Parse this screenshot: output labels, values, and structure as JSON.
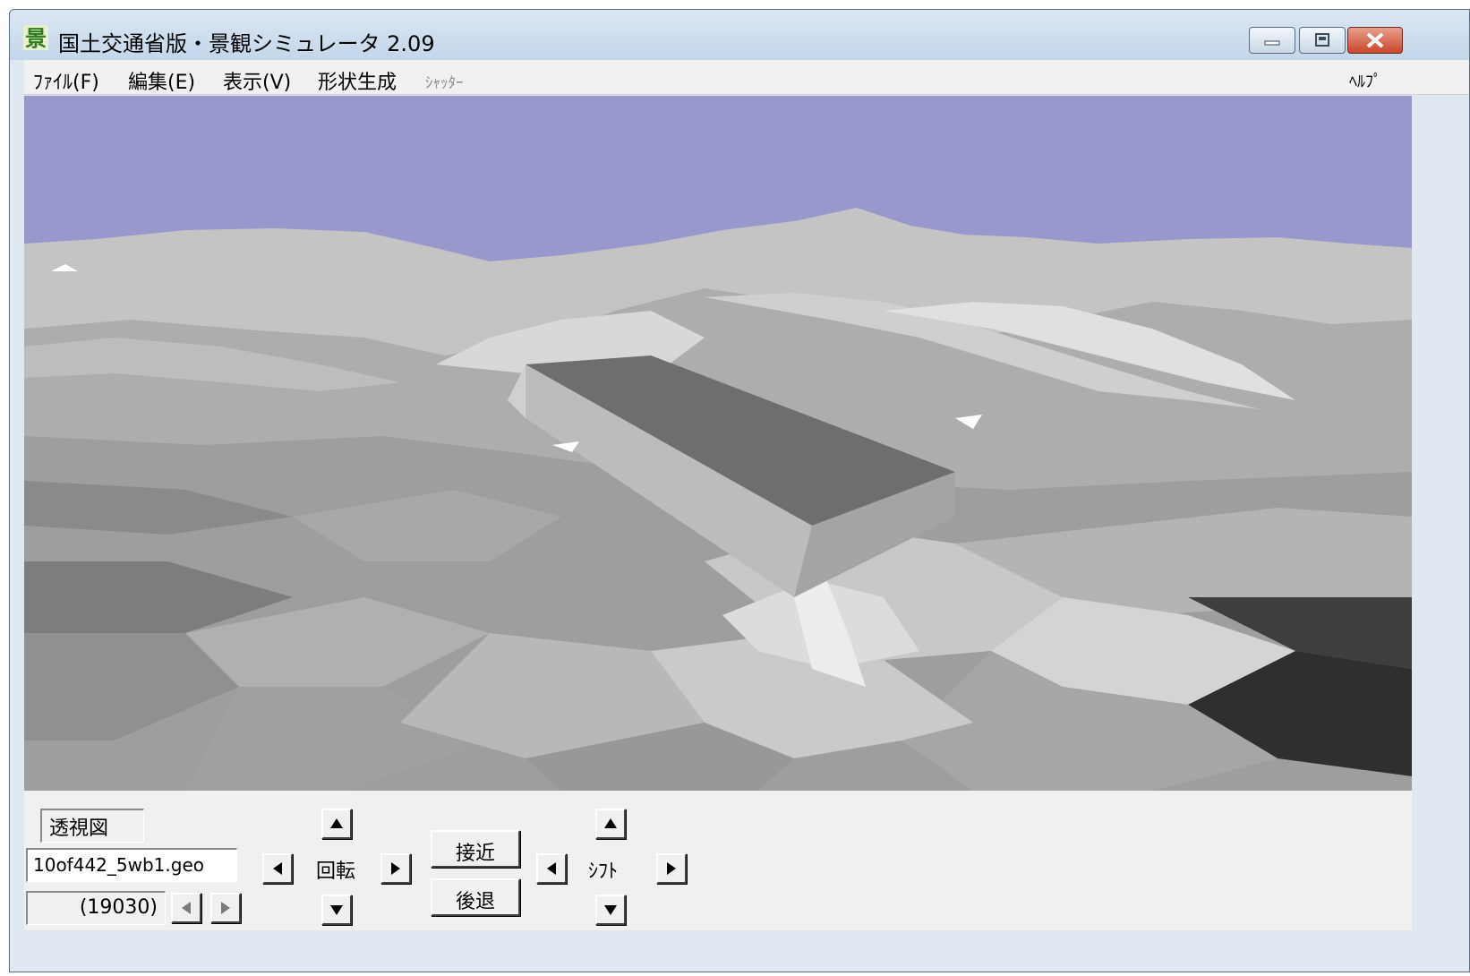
{
  "window": {
    "title": "国土交通省版・景観シミュレータ 2.09",
    "accent_color": "#c9462c",
    "sky_color": "#9898cc"
  },
  "titlebar": {
    "icon": "app-landscape-icon",
    "controls": [
      "minimize-icon",
      "maximize-icon",
      "close-icon"
    ]
  },
  "menu": {
    "file": "ﾌｧｲﾙ(F)",
    "edit": "編集(E)",
    "view": "表示(V)",
    "shape": "形状生成",
    "shutter": "ｼｬｯﾀｰ",
    "help": "ﾍﾙﾌﾟ"
  },
  "controls": {
    "view_mode": "透視図",
    "file_name": "10of442_5wb1.geo",
    "frame": "(19030)",
    "rotate_label": "回転",
    "approach_label": "接近",
    "retreat_label": "後退",
    "shift_label": "ｼﾌﾄ"
  }
}
